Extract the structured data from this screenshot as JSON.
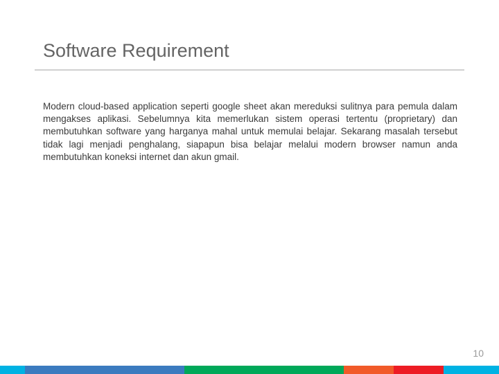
{
  "title": "Software Requirement",
  "body": "Modern cloud-based application seperti google sheet akan mereduksi sulitnya para pemula dalam mengakses aplikasi. Sebelumnya kita memerlukan sistem operasi tertentu (proprietary) dan membutuhkan software yang harganya mahal untuk memulai belajar. Sekarang masalah tersebut tidak lagi menjadi penghalang, siapapun bisa belajar melalui modern browser namun anda membutuhkan koneksi internet dan akun gmail.",
  "page_number": "10",
  "stripe_colors": [
    "#00b2e3",
    "#3b7bbf",
    "#00a859",
    "#f15a29",
    "#ed1c24",
    "#00b2e3"
  ],
  "stripe_widths": [
    36,
    230,
    230,
    72,
    72,
    80
  ]
}
